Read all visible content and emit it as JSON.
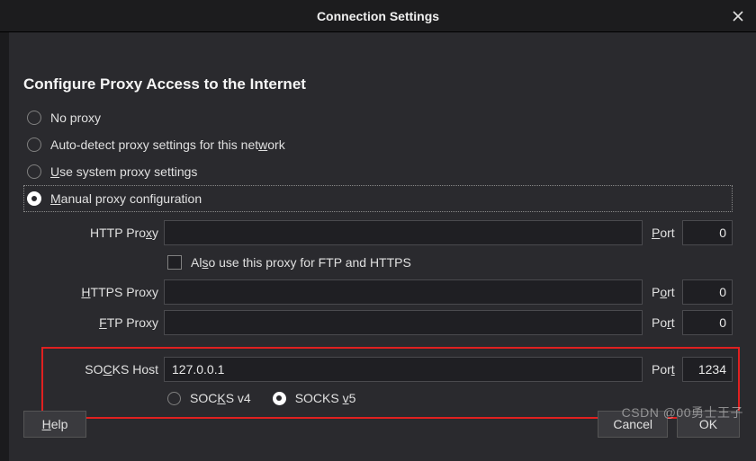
{
  "window": {
    "title": "Connection Settings"
  },
  "heading": "Configure Proxy Access to the Internet",
  "proxy_mode": {
    "options": {
      "no_proxy": "No proxy",
      "auto_detect_pre": "Auto-detect proxy settings for this net",
      "auto_detect_u": "w",
      "auto_detect_post": "ork",
      "system_u": "U",
      "system_post": "se system proxy settings",
      "manual_u": "M",
      "manual_post": "anual proxy configuration"
    }
  },
  "form": {
    "http": {
      "label_pre": "HTTP Pro",
      "label_u": "x",
      "label_post": "y",
      "host": "",
      "port_u": "P",
      "port_post": "ort",
      "port": "0"
    },
    "also_checkbox": {
      "pre": "Al",
      "u": "s",
      "post": "o use this proxy for FTP and HTTPS"
    },
    "https": {
      "label_u": "H",
      "label_post": "TTPS Proxy",
      "host": "",
      "port_pre": "P",
      "port_u": "o",
      "port_post": "rt",
      "port": "0"
    },
    "ftp": {
      "label_u": "F",
      "label_post": "TP Proxy",
      "host": "",
      "port_pre": "Po",
      "port_u": "r",
      "port_post": "t",
      "port": "0"
    },
    "socks": {
      "label_pre": "SO",
      "label_u": "C",
      "label_post": "KS Host",
      "host": "127.0.0.1",
      "port_pre": "Por",
      "port_u": "t",
      "port": "1234"
    },
    "socks_version": {
      "v4_pre": "SOC",
      "v4_u": "K",
      "v4_post": "S v4",
      "v5_pre": "SOCKS ",
      "v5_u": "v",
      "v5_post": "5"
    }
  },
  "buttons": {
    "help_u": "H",
    "help_post": "elp",
    "cancel": "Cancel",
    "ok": "OK"
  },
  "watermark": "CSDN @00勇士王子"
}
